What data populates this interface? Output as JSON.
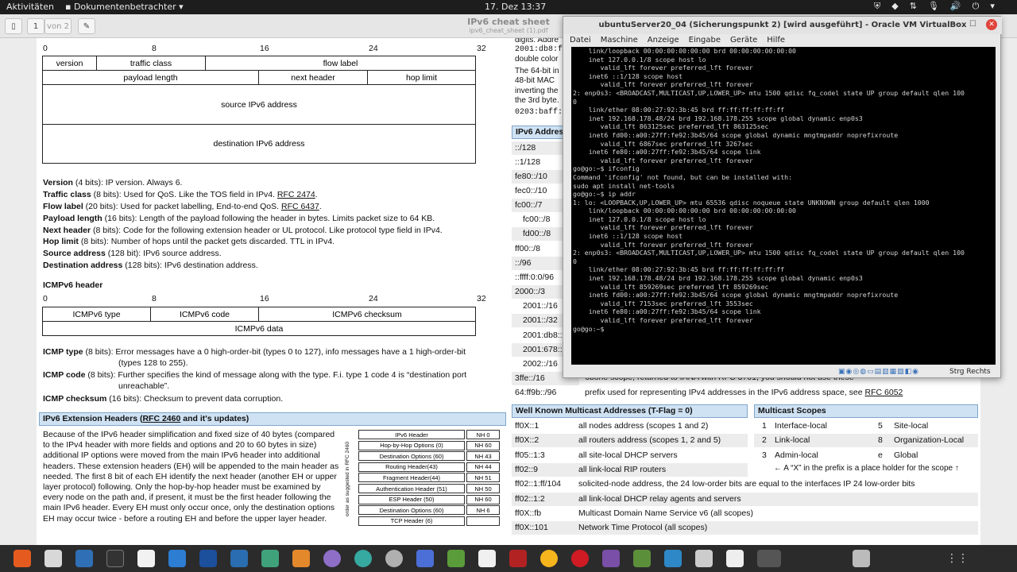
{
  "topbar": {
    "activities": "Aktivitäten",
    "app_menu": "Dokumentenbetrachter ▾",
    "clock": "17. Dez  13:37"
  },
  "viewer": {
    "page_number": "1",
    "page_total": "von 2",
    "title": "IPv6 cheat sheet",
    "subtitle": "ipv6_cheat_sheet (1).pdf"
  },
  "header_diagram": {
    "ticks": [
      "0",
      "8",
      "16",
      "24",
      "32"
    ],
    "row1": [
      "version",
      "traffic class",
      "flow label"
    ],
    "row2": [
      "payload length",
      "next header",
      "hop limit"
    ],
    "src": "source IPv6 address",
    "dst": "destination IPv6 address"
  },
  "fields": [
    {
      "name": "Version",
      "text": " (4 bits): IP version. Always 6."
    },
    {
      "name": "Traffic class",
      "text": " (8 bits): Used for QoS. Like the TOS field in IPv4. ",
      "link": "RFC 2474",
      "end": "."
    },
    {
      "name": "Flow label",
      "text": " (20 bits): Used for packet labelling, End-to-end QoS. ",
      "link": "RFC 6437",
      "end": "."
    },
    {
      "name": "Payload length",
      "text": " (16 bits): Length of the payload following the header in bytes. Limits packet size to 64 KB."
    },
    {
      "name": "Next header",
      "text": " (8 bits): Code for the following extension header or UL protocol. Like protocol type field in IPv4."
    },
    {
      "name": "Hop limit",
      "text": " (8 bits): Number of hops until the packet gets discarded. TTL in IPv4."
    },
    {
      "name": "Source address",
      "text": " (128 bit): IPv6 source address."
    },
    {
      "name": "Destination address",
      "text": " (128 bits): IPv6 destination address."
    }
  ],
  "icmp": {
    "title": "ICMPv6 header",
    "ticks": [
      "0",
      "8",
      "16",
      "24",
      "32"
    ],
    "row1": [
      "ICMPv6 type",
      "ICMPv6 code",
      "ICMPv6 checksum"
    ],
    "row2": "ICMPv6 data",
    "type_name": "ICMP type",
    "type_text": " (8 bits): Error messages have a 0 high-order-bit (types 0 to 127), info messages have a 1 high-order-bit",
    "type_text2": "(types 128 to 255).",
    "code_name": "ICMP code",
    "code_text": " (8 bits): Further specifies the kind of message along with the type. F.i. type 1 code 4 is “destination port",
    "code_text2": "unreachable”.",
    "sum_name": "ICMP checksum",
    "sum_text": " (16 bits): Checksum to prevent data corruption."
  },
  "ext": {
    "title_a": "IPv6 Extension Headers (",
    "title_link": "RFC 2460",
    "title_b": " and it's updates)",
    "paragraph": "Because of the IPv6 header simplification and fixed size of 40 bytes (compared to the IPv4 header with more fields and options and 20 to 60 bytes in size) additional IP options were moved from the main IPv6 header into additional headers. These extension headers (EH) will be appended to the main header as needed. The first 8 bit of each EH identify the next header (another EH or upper layer protocol) following. Only the hop-by-hop header must be examined by every node on the path and, if present, it must be the first header following the main IPv6 header. Every EH must only occur once, only the destination options EH may occur twice - before a routing EH and before the upper layer header.",
    "side_label": "order as suggested in RFC 2460",
    "headers": [
      [
        "IPv6 Header",
        "NH 0"
      ],
      [
        "Hop-by-Hop Options (0)",
        "NH 60"
      ],
      [
        "Destination Options (60)",
        "NH 43"
      ],
      [
        "Routing Header(43)",
        "NH 44"
      ],
      [
        "Fragment Header(44)",
        "NH 51"
      ],
      [
        "Authentication Header (51)",
        "NH 50"
      ],
      [
        "ESP Header (50)",
        "NH 60"
      ],
      [
        "Destination Options (60)",
        "NH 6"
      ],
      [
        "TCP Header (6)",
        ""
      ]
    ]
  },
  "right_partial": {
    "lines": [
      "digits. Addre",
      "2001:db8:f",
      "double color",
      "The 64-bit in",
      "48-bit MAC",
      "inverting the",
      "the 3rd byte.",
      "0203:baff:"
    ]
  },
  "addresses": {
    "title": "IPv6 Addres",
    "items": [
      "::/128",
      "::1/128",
      "fe80::/10",
      "fec0::/10",
      "fc00::/7",
      "fc00::/8",
      "fd00::/8",
      "ff00::/8",
      "::/96",
      "::ffff:0:0/96",
      "2000::/3",
      "2001::/16",
      "2001::/32",
      "2001:db8::",
      "2001:678::",
      "2002::/16",
      "3ffe::/16",
      "64:ff9b::/96"
    ],
    "row_3ffe_text": "6bone scope, returned to IANA with RFC 3701, you should not use these",
    "row_64_text": "prefix used for representing IPv4 addresses in the IPv6 address space, see ",
    "row_64_link": "RFC 6052"
  },
  "multicast": {
    "title": "Well Known Multicast Addresses (T-Flag = 0)",
    "rows": [
      [
        "ff0X::1",
        "all nodes address (scopes 1 and 2)"
      ],
      [
        "ff0X::2",
        "all routers address (scopes 1, 2 and 5)"
      ],
      [
        "ff05::1:3",
        "all site-local DHCP servers"
      ],
      [
        "ff02::9",
        "all link-local RIP routers"
      ],
      [
        "ff02::1:ff/104",
        "solicited-node address, the 24 low-order bits are equal to the interfaces IP 24 low-order bits"
      ],
      [
        "ff02::1:2",
        "all link-local DHCP relay agents and servers"
      ],
      [
        "ff0X::fb",
        "Multicast Domain Name Service v6 (all scopes)"
      ],
      [
        "ff0X::101",
        "Network Time Protocol (all scopes)"
      ]
    ]
  },
  "scopes": {
    "title": "Multicast Scopes",
    "rows": [
      [
        "1",
        "Interface-local",
        "5",
        "Site-local"
      ],
      [
        "2",
        "Link-local",
        "8",
        "Organization-Local"
      ],
      [
        "3",
        "Admin-local",
        "e",
        "Global"
      ]
    ],
    "note": "← A “X” in the prefix is a place holder for the scope ↑"
  },
  "vbox": {
    "title": "ubuntuServer20_04 (Sicherungspunkt 2) [wird ausgeführt] - Oracle VM VirtualBox",
    "menu": [
      "Datei",
      "Maschine",
      "Anzeige",
      "Eingabe",
      "Geräte",
      "Hilfe"
    ],
    "status_key": "Strg Rechts",
    "terminal": [
      "    link/loopback 00:00:00:00:00:00 brd 00:00:00:00:00:00",
      "    inet 127.0.0.1/8 scope host lo",
      "       valid_lft forever preferred_lft forever",
      "    inet6 ::1/128 scope host",
      "       valid_lft forever preferred_lft forever",
      "2: enp0s3: <BROADCAST,MULTICAST,UP,LOWER_UP> mtu 1500 qdisc fq_codel state UP group default qlen 100",
      "0",
      "    link/ether 08:00:27:92:3b:45 brd ff:ff:ff:ff:ff:ff",
      "    inet 192.168.178.48/24 brd 192.168.178.255 scope global dynamic enp0s3",
      "       valid_lft 863125sec preferred_lft 863125sec",
      "    inet6 fd00::a00:27ff:fe92:3b45/64 scope global dynamic mngtmpaddr noprefixroute",
      "       valid_lft 6867sec preferred_lft 3267sec",
      "    inet6 fe80::a00:27ff:fe92:3b45/64 scope link",
      "       valid_lft forever preferred_lft forever",
      "go@go:~$ ifconfig",
      "",
      "Command 'ifconfig' not found, but can be installed with:",
      "",
      "sudo apt install net-tools",
      "",
      "go@go:~$ ip addr",
      "1: lo: <LOOPBACK,UP,LOWER_UP> mtu 65536 qdisc noqueue state UNKNOWN group default qlen 1000",
      "    link/loopback 00:00:00:00:00:00 brd 00:00:00:00:00:00",
      "    inet 127.0.0.1/8 scope host lo",
      "       valid_lft forever preferred_lft forever",
      "    inet6 ::1/128 scope host",
      "       valid_lft forever preferred_lft forever",
      "2: enp0s3: <BROADCAST,MULTICAST,UP,LOWER_UP> mtu 1500 qdisc fq_codel state UP group default qlen 100",
      "0",
      "    link/ether 08:00:27:92:3b:45 brd ff:ff:ff:ff:ff:ff",
      "    inet 192.168.178.48/24 brd 192.168.178.255 scope global dynamic enp0s3",
      "       valid_lft 859269sec preferred_lft 859269sec",
      "    inet6 fd00::a00:27ff:fe92:3b45/64 scope global dynamic mngtmpaddr noprefixroute",
      "       valid_lft 7153sec preferred_lft 3553sec",
      "    inet6 fe80::a00:27ff:fe92:3b45/64 scope link",
      "       valid_lft forever preferred_lft forever",
      "go@go:~$ "
    ]
  },
  "colors": {
    "section_bar": "#cfe2f3",
    "terminal_bg": "#000000",
    "dock_bg": "#2b2b2b"
  }
}
